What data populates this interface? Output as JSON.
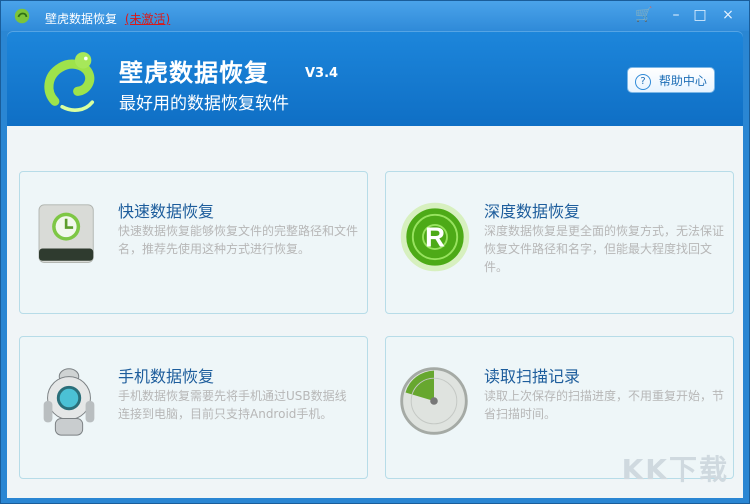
{
  "window": {
    "title": "壁虎数据恢复",
    "status": "(未激活)",
    "buttons": {
      "cart": "🛒",
      "minimize": "–",
      "maximize": "□",
      "close": "×"
    }
  },
  "header": {
    "app_name": "壁虎数据恢复",
    "version": "V3.4",
    "subtitle": "最好用的数据恢复软件",
    "help_label": "帮助中心"
  },
  "cards": [
    {
      "title": "快速数据恢复",
      "description": "快速数据恢复能够恢复文件的完整路径和文件名，推荐先使用这种方式进行恢复。"
    },
    {
      "title": "深度数据恢复",
      "description": "深度数据恢复是更全面的恢复方式，无法保证恢复文件路径和名字，但能最大程度找回文件。"
    },
    {
      "title": "手机数据恢复",
      "description": "手机数据恢复需要先将手机通过USB数据线连接到电脑，目前只支持Android手机。"
    },
    {
      "title": "读取扫描记录",
      "description": "读取上次保存的扫描进度，不用重复开始，节省扫描时间。"
    }
  ],
  "watermark": "KK下载"
}
